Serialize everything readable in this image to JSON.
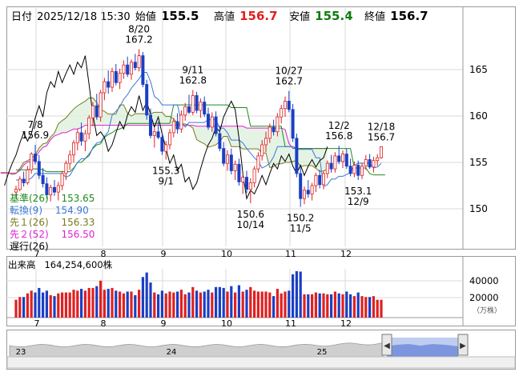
{
  "header": {
    "date_label": "日付",
    "datetime": "2025/12/18 15:30",
    "open_label": "始値",
    "open": "155.5",
    "high_label": "高値",
    "high": "156.7",
    "low_label": "安値",
    "low": "155.4",
    "close_label": "終値",
    "close": "156.7"
  },
  "legend": [
    {
      "label": "基準(26)",
      "value": "153.65",
      "color": "#1e8c1e"
    },
    {
      "label": "転換(9)",
      "value": "154.90",
      "color": "#3a78d8"
    },
    {
      "label": "先１(26)",
      "value": "156.33",
      "color": "#7a7a20"
    },
    {
      "label": "先２(52)",
      "value": "156.50",
      "color": "#e020d0"
    },
    {
      "label": "遅行(26)",
      "value": "",
      "color": "#000000"
    }
  ],
  "annotations": [
    {
      "date": "8/20",
      "value": "167.2",
      "i": 32,
      "y": 167.2,
      "pos": "above"
    },
    {
      "date": "9/11",
      "value": "162.8",
      "i": 46,
      "y": 162.8,
      "pos": "above"
    },
    {
      "date": "10/27",
      "value": "162.7",
      "i": 71,
      "y": 162.7,
      "pos": "above"
    },
    {
      "date": "7/8",
      "value": "156.9",
      "i": 5,
      "y": 156.9,
      "pos": "above"
    },
    {
      "date": "12/2",
      "value": "156.8",
      "i": 84,
      "y": 156.8,
      "pos": "above"
    },
    {
      "date": "12/18",
      "value": "156.7",
      "i": 95,
      "y": 156.7,
      "pos": "above"
    },
    {
      "date": "9/1",
      "value": "155.3",
      "i": 39,
      "y": 155.3,
      "pos": "below"
    },
    {
      "date": "10/14",
      "value": "150.6",
      "i": 61,
      "y": 150.6,
      "pos": "below"
    },
    {
      "date": "11/5",
      "value": "150.2",
      "i": 74,
      "y": 150.2,
      "pos": "below"
    },
    {
      "date": "12/9",
      "value": "153.1",
      "i": 89,
      "y": 153.1,
      "pos": "below"
    }
  ],
  "volume": {
    "title": "出来高",
    "value": "164,254,600株",
    "unit": "（万株）",
    "ticks": [
      40000,
      20000
    ]
  },
  "navigator": {
    "labels": [
      "23",
      "24",
      "25"
    ],
    "left_handle": "◀",
    "right_handle": "▶"
  },
  "chart_data": {
    "type": "candlestick",
    "ylim": [
      146,
      171
    ],
    "y_ticks": [
      150,
      155,
      160,
      165
    ],
    "x_month_labels": [
      "7",
      "8",
      "9",
      "10",
      "11",
      "12"
    ],
    "grid": true,
    "legend_position": "bottom-left",
    "colors": {
      "up": "#e02020",
      "down": "#1a3fc4",
      "kijun": "#1e8c1e",
      "tenkan": "#3a78d8",
      "senkou_a": "#7a7a20",
      "senkou_b": "#e020d0",
      "chikou": "#000000",
      "cloud": "#dff0df"
    },
    "ohlc": [
      [
        151.8,
        152.5,
        151.2,
        152.1
      ],
      [
        152.1,
        153.5,
        151.9,
        153.2
      ],
      [
        153.2,
        154.0,
        152.4,
        152.8
      ],
      [
        152.8,
        154.6,
        152.6,
        154.2
      ],
      [
        154.2,
        156.1,
        153.8,
        155.9
      ],
      [
        155.9,
        156.9,
        154.8,
        155.1
      ],
      [
        155.1,
        155.8,
        153.2,
        153.6
      ],
      [
        153.6,
        154.4,
        152.3,
        152.7
      ],
      [
        152.7,
        153.4,
        151.1,
        151.5
      ],
      [
        151.5,
        152.6,
        150.8,
        152.3
      ],
      [
        152.3,
        153.1,
        151.4,
        151.8
      ],
      [
        151.8,
        152.9,
        150.9,
        152.5
      ],
      [
        152.5,
        154.1,
        152.0,
        153.8
      ],
      [
        153.8,
        155.2,
        153.1,
        154.9
      ],
      [
        154.9,
        156.3,
        154.2,
        155.8
      ],
      [
        155.8,
        157.4,
        155.0,
        157.1
      ],
      [
        157.1,
        158.6,
        156.3,
        158.2
      ],
      [
        158.2,
        159.3,
        156.8,
        157.3
      ],
      [
        157.3,
        158.5,
        156.2,
        158.1
      ],
      [
        158.1,
        160.1,
        157.5,
        159.8
      ],
      [
        159.8,
        161.5,
        158.9,
        161.1
      ],
      [
        161.1,
        162.4,
        159.6,
        159.9
      ],
      [
        159.9,
        162.8,
        159.4,
        162.5
      ],
      [
        162.5,
        164.1,
        161.7,
        163.7
      ],
      [
        163.7,
        164.9,
        162.4,
        163.1
      ],
      [
        163.1,
        165.2,
        162.6,
        164.8
      ],
      [
        164.8,
        165.6,
        163.3,
        163.6
      ],
      [
        163.6,
        165.1,
        162.9,
        164.6
      ],
      [
        164.6,
        166.0,
        164.0,
        165.5
      ],
      [
        165.5,
        166.4,
        164.2,
        164.5
      ],
      [
        164.5,
        166.1,
        163.9,
        165.8
      ],
      [
        165.8,
        166.7,
        164.9,
        165.2
      ],
      [
        165.2,
        167.2,
        164.8,
        166.5
      ],
      [
        166.5,
        166.9,
        163.1,
        163.4
      ],
      [
        163.4,
        163.9,
        159.6,
        160.1
      ],
      [
        160.1,
        160.8,
        157.6,
        157.9
      ],
      [
        157.9,
        158.7,
        156.6,
        158.3
      ],
      [
        158.3,
        159.4,
        157.5,
        157.7
      ],
      [
        157.7,
        158.1,
        155.8,
        156.2
      ],
      [
        156.2,
        157.3,
        155.3,
        156.9
      ],
      [
        156.9,
        158.6,
        156.4,
        158.2
      ],
      [
        158.2,
        159.8,
        157.7,
        159.4
      ],
      [
        159.4,
        160.3,
        158.1,
        158.6
      ],
      [
        158.6,
        160.6,
        158.2,
        160.1
      ],
      [
        160.1,
        161.4,
        159.5,
        161.0
      ],
      [
        161.0,
        162.3,
        160.2,
        160.4
      ],
      [
        160.4,
        162.8,
        160.1,
        162.2
      ],
      [
        162.2,
        162.6,
        160.3,
        160.6
      ],
      [
        160.6,
        161.9,
        159.8,
        161.5
      ],
      [
        161.5,
        162.1,
        159.9,
        160.2
      ],
      [
        160.2,
        160.9,
        158.5,
        158.8
      ],
      [
        158.8,
        160.4,
        158.3,
        159.9
      ],
      [
        159.9,
        160.5,
        157.8,
        158.1
      ],
      [
        158.1,
        158.9,
        156.2,
        156.5
      ],
      [
        156.5,
        157.2,
        154.6,
        154.9
      ],
      [
        154.9,
        156.3,
        154.1,
        155.8
      ],
      [
        155.8,
        156.5,
        153.7,
        154.1
      ],
      [
        154.1,
        155.2,
        153.1,
        154.8
      ],
      [
        154.8,
        155.4,
        152.5,
        152.9
      ],
      [
        152.9,
        153.8,
        151.6,
        153.4
      ],
      [
        153.4,
        154.1,
        151.7,
        152.1
      ],
      [
        152.1,
        153.3,
        150.6,
        152.8
      ],
      [
        152.8,
        154.6,
        152.3,
        154.3
      ],
      [
        154.3,
        156.1,
        153.9,
        155.7
      ],
      [
        155.7,
        157.4,
        155.2,
        156.9
      ],
      [
        156.9,
        158.3,
        156.1,
        157.6
      ],
      [
        157.6,
        159.2,
        157.1,
        158.8
      ],
      [
        158.8,
        159.6,
        157.9,
        158.3
      ],
      [
        158.3,
        160.3,
        157.8,
        159.9
      ],
      [
        159.9,
        161.2,
        159.2,
        160.8
      ],
      [
        160.8,
        162.1,
        159.9,
        161.6
      ],
      [
        161.6,
        162.7,
        160.4,
        160.7
      ],
      [
        160.7,
        161.3,
        157.2,
        157.6
      ],
      [
        157.6,
        158.1,
        153.4,
        153.8
      ],
      [
        153.8,
        154.6,
        150.2,
        151.1
      ],
      [
        151.1,
        152.4,
        150.5,
        152.0
      ],
      [
        152.0,
        153.1,
        151.2,
        151.6
      ],
      [
        151.6,
        152.8,
        150.9,
        152.5
      ],
      [
        152.5,
        153.9,
        151.8,
        153.6
      ],
      [
        153.6,
        154.2,
        152.2,
        152.6
      ],
      [
        152.6,
        154.1,
        152.1,
        153.8
      ],
      [
        153.8,
        155.2,
        153.3,
        154.9
      ],
      [
        154.9,
        155.8,
        153.9,
        154.3
      ],
      [
        154.3,
        156.1,
        153.9,
        155.7
      ],
      [
        155.7,
        156.8,
        154.8,
        155.1
      ],
      [
        155.1,
        156.3,
        154.4,
        155.9
      ],
      [
        155.9,
        156.5,
        154.3,
        154.6
      ],
      [
        154.6,
        155.4,
        153.5,
        153.8
      ],
      [
        153.8,
        155.1,
        153.4,
        154.7
      ],
      [
        154.7,
        155.2,
        153.1,
        153.6
      ],
      [
        153.6,
        154.9,
        153.2,
        154.6
      ],
      [
        154.6,
        155.8,
        154.2,
        155.3
      ],
      [
        155.3,
        155.9,
        154.3,
        154.5
      ],
      [
        154.5,
        155.6,
        153.9,
        155.2
      ],
      [
        155.2,
        155.9,
        154.6,
        155.5
      ],
      [
        155.5,
        156.7,
        155.4,
        156.7
      ]
    ],
    "kijun": [
      154.2,
      154.2,
      154.2,
      154.2,
      154.3,
      154.3,
      154.3,
      154.2,
      154.0,
      154.0,
      154.0,
      154.0,
      154.0,
      154.0,
      154.0,
      154.4,
      155.0,
      155.0,
      155.4,
      155.9,
      156.5,
      156.9,
      157.0,
      157.7,
      158.0,
      158.2,
      158.5,
      158.6,
      158.8,
      159.2,
      159.2,
      159.2,
      159.2,
      159.2,
      159.2,
      159.2,
      159.2,
      159.2,
      159.2,
      159.2,
      159.2,
      161.2,
      161.2,
      161.2,
      161.2,
      161.2,
      161.2,
      161.2,
      161.2,
      161.2,
      161.2,
      161.2,
      161.2,
      161.2,
      161.2,
      161.2,
      160.9,
      160.9,
      160.9,
      160.9,
      160.9,
      158.9,
      158.9,
      158.9,
      158.9,
      158.9,
      158.9,
      158.9,
      158.9,
      158.9,
      156.7,
      156.7,
      156.7,
      156.5,
      156.5,
      156.5,
      156.5,
      156.5,
      156.5,
      156.5,
      156.5,
      156.5,
      156.5,
      156.5,
      156.5,
      156.5,
      156.5,
      156.5,
      154.4,
      154.4,
      154.4,
      154.4,
      153.8,
      153.65,
      153.65,
      153.65,
      153.65
    ],
    "tenkan": [
      153.1,
      153.1,
      153.1,
      153.1,
      153.3,
      153.8,
      153.8,
      153.8,
      153.8,
      153.8,
      153.8,
      153.8,
      153.8,
      153.4,
      153.6,
      154.3,
      155.0,
      155.4,
      155.4,
      155.7,
      156.6,
      157.1,
      157.2,
      157.8,
      158.3,
      160.1,
      160.5,
      161.0,
      161.8,
      162.3,
      163.0,
      163.5,
      164.0,
      164.7,
      164.7,
      163.7,
      162.1,
      161.8,
      161.2,
      161.2,
      161.2,
      161.2,
      161.2,
      159.4,
      158.8,
      159.3,
      159.3,
      159.3,
      159.3,
      159.3,
      159.6,
      159.6,
      159.6,
      158.7,
      158.7,
      158.2,
      157.4,
      157.4,
      157.4,
      157.1,
      156.5,
      156.0,
      155.5,
      155.1,
      154.4,
      154.6,
      154.9,
      155.6,
      156.7,
      156.7,
      156.7,
      156.7,
      156.7,
      156.4,
      156.4,
      156.4,
      156.4,
      156.4,
      155.5,
      155.5,
      152.4,
      152.6,
      153.2,
      153.2,
      153.5,
      153.5,
      153.7,
      153.9,
      154.7,
      154.9,
      154.9,
      154.9,
      154.9,
      154.4,
      154.5,
      154.9
    ]
  }
}
